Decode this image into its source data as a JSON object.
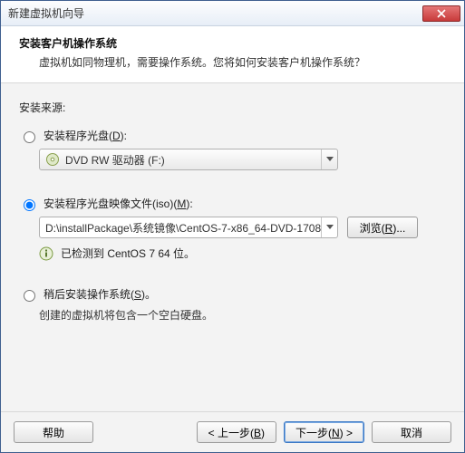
{
  "window": {
    "title": "新建虚拟机向导"
  },
  "header": {
    "title": "安装客户机操作系统",
    "subtitle": "虚拟机如同物理机，需要操作系统。您将如何安装客户机操作系统？"
  },
  "body": {
    "source_label": "安装来源:",
    "option_disc": {
      "label": "安装程序光盘(",
      "key": "D",
      "after": "):",
      "drive_text": "DVD RW 驱动器 (F:)"
    },
    "option_iso": {
      "label": "安装程序光盘映像文件(iso)(",
      "key": "M",
      "after": "):",
      "path": "D:\\installPackage\\系统镜像\\CentOS-7-x86_64-DVD-1708",
      "browse": "浏览(",
      "browse_key": "R",
      "browse_after": ")...",
      "detected": "已检测到 CentOS 7 64 位。"
    },
    "option_later": {
      "label": "稍后安装操作系统(",
      "key": "S",
      "after": ")。",
      "note": "创建的虚拟机将包含一个空白硬盘。"
    }
  },
  "footer": {
    "help": "帮助",
    "back": "< 上一步(",
    "back_key": "B",
    "back_after": ")",
    "next_prefix": "下一步(",
    "next_key": "N",
    "next_after": ") >",
    "cancel": "取消"
  }
}
